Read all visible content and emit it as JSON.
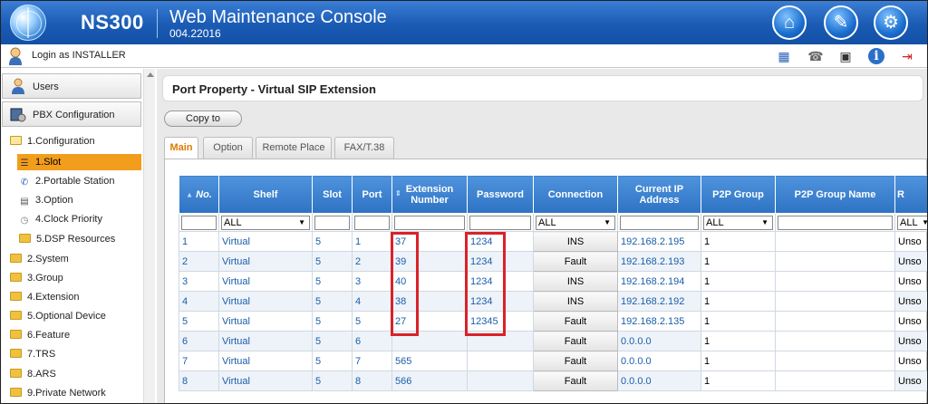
{
  "header": {
    "model": "NS300",
    "console_title": "Web Maintenance Console",
    "version": "004.22016"
  },
  "toolbar": {
    "login_text": "Login as INSTALLER"
  },
  "sidebar": {
    "users_label": "Users",
    "pbx_label": "PBX Configuration",
    "tree": [
      {
        "label": "1.Configuration",
        "level": 0,
        "open": true
      },
      {
        "label": "1.Slot",
        "level": 1,
        "selected": true
      },
      {
        "label": "2.Portable Station",
        "level": 1
      },
      {
        "label": "3.Option",
        "level": 1
      },
      {
        "label": "4.Clock Priority",
        "level": 1
      },
      {
        "label": "5.DSP Resources",
        "level": 1
      },
      {
        "label": "2.System",
        "level": 0
      },
      {
        "label": "3.Group",
        "level": 0
      },
      {
        "label": "4.Extension",
        "level": 0
      },
      {
        "label": "5.Optional Device",
        "level": 0
      },
      {
        "label": "6.Feature",
        "level": 0
      },
      {
        "label": "7.TRS",
        "level": 0
      },
      {
        "label": "8.ARS",
        "level": 0
      },
      {
        "label": "9.Private Network",
        "level": 0
      }
    ]
  },
  "main": {
    "page_title": "Port Property - Virtual SIP Extension",
    "copy_label": "Copy to",
    "tabs": [
      {
        "label": "Main",
        "active": true
      },
      {
        "label": "Option"
      },
      {
        "label": "Remote Place"
      },
      {
        "label": "FAX/T.38"
      }
    ],
    "columns": [
      "No.",
      "Shelf",
      "Slot",
      "Port",
      "Extension Number",
      "Password",
      "Connection",
      "Current IP Address",
      "P2P Group",
      "P2P Group Name",
      "R"
    ],
    "filters": {
      "shelf": "ALL",
      "connection": "ALL",
      "p2p_group": "ALL",
      "last": "ALL"
    },
    "rows": [
      {
        "no": "1",
        "shelf": "Virtual",
        "slot": "5",
        "port": "1",
        "ext": "37",
        "password": "1234",
        "connection": "INS",
        "ip": "192.168.2.195",
        "p2p": "1",
        "last": "Unso"
      },
      {
        "no": "2",
        "shelf": "Virtual",
        "slot": "5",
        "port": "2",
        "ext": "39",
        "password": "1234",
        "connection": "Fault",
        "ip": "192.168.2.193",
        "p2p": "1",
        "last": "Unso"
      },
      {
        "no": "3",
        "shelf": "Virtual",
        "slot": "5",
        "port": "3",
        "ext": "40",
        "password": "1234",
        "connection": "INS",
        "ip": "192.168.2.194",
        "p2p": "1",
        "last": "Unso"
      },
      {
        "no": "4",
        "shelf": "Virtual",
        "slot": "5",
        "port": "4",
        "ext": "38",
        "password": "1234",
        "connection": "INS",
        "ip": "192.168.2.192",
        "p2p": "1",
        "last": "Unso"
      },
      {
        "no": "5",
        "shelf": "Virtual",
        "slot": "5",
        "port": "5",
        "ext": "27",
        "password": "12345",
        "connection": "Fault",
        "ip": "192.168.2.135",
        "p2p": "1",
        "last": "Unso"
      },
      {
        "no": "6",
        "shelf": "Virtual",
        "slot": "5",
        "port": "6",
        "ext": "",
        "password": "",
        "connection": "Fault",
        "ip": "0.0.0.0",
        "p2p": "1",
        "last": "Unso"
      },
      {
        "no": "7",
        "shelf": "Virtual",
        "slot": "5",
        "port": "7",
        "ext": "565",
        "password": "",
        "connection": "Fault",
        "ip": "0.0.0.0",
        "p2p": "1",
        "last": "Unso"
      },
      {
        "no": "8",
        "shelf": "Virtual",
        "slot": "5",
        "port": "8",
        "ext": "566",
        "password": "",
        "connection": "Fault",
        "ip": "0.0.0.0",
        "p2p": "1",
        "last": "Unso"
      }
    ]
  },
  "colors": {
    "header_blue": "#1a5bb4",
    "selected_orange": "#f29d1b",
    "highlight_red": "#d9222a",
    "link_blue": "#1a5ea9"
  }
}
